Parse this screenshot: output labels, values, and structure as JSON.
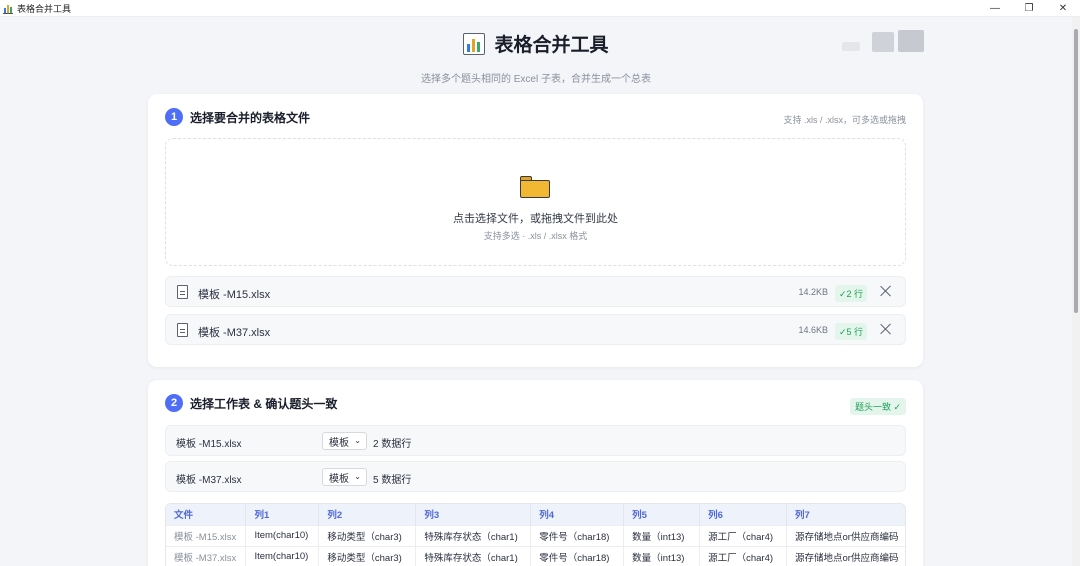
{
  "window": {
    "title": "表格合并工具",
    "controls": {
      "minimize": "—",
      "restore": "❐",
      "close": "✕"
    }
  },
  "header": {
    "title": "表格合并工具",
    "subtitle": "选择多个题头相同的 Excel 子表，合并生成一个总表"
  },
  "step1": {
    "number": "1",
    "title": "选择要合并的表格文件",
    "hint": "支持 .xls / .xlsx，可多选或拖拽",
    "dropzone": {
      "main": "点击选择文件，或拖拽文件到此处",
      "sub": "支持多选 · .xls / .xlsx 格式"
    },
    "files": [
      {
        "name": "模板 -M15.xlsx",
        "size": "14.2KB",
        "rows": "✓2 行"
      },
      {
        "name": "模板 -M37.xlsx",
        "size": "14.6KB",
        "rows": "✓5 行"
      }
    ]
  },
  "step2": {
    "number": "2",
    "title": "选择工作表 & 确认题头一致",
    "status_badge": "题头一致 ✓",
    "sheets": [
      {
        "file": "模板 -M15.xlsx",
        "selected": "模板",
        "count": "2 数据行"
      },
      {
        "file": "模板 -M37.xlsx",
        "selected": "模板",
        "count": "5 数据行"
      }
    ],
    "preview": {
      "columns": [
        "文件",
        "列1",
        "列2",
        "列3",
        "列4",
        "列5",
        "列6",
        "列7"
      ],
      "rows": [
        [
          "模板 -M15.xlsx",
          "Item(char10)",
          "移动类型（char3)",
          "特殊库存状态（char1)",
          "零件号（char18)",
          "数量（int13)",
          "源工厂（char4)",
          "源存储地点or供应商编码（"
        ],
        [
          "模板 -M37.xlsx",
          "Item(char10)",
          "移动类型（char3)",
          "特殊库存状态（char1)",
          "零件号（char18)",
          "数量（int13)",
          "源工厂（char4)",
          "源存储地点or供应商编码（"
        ]
      ]
    }
  },
  "colors": {
    "accent": "#4f6ef7",
    "success": "#1f9d57",
    "success_bg": "#e4f6ec",
    "background": "#f4f5f8"
  }
}
